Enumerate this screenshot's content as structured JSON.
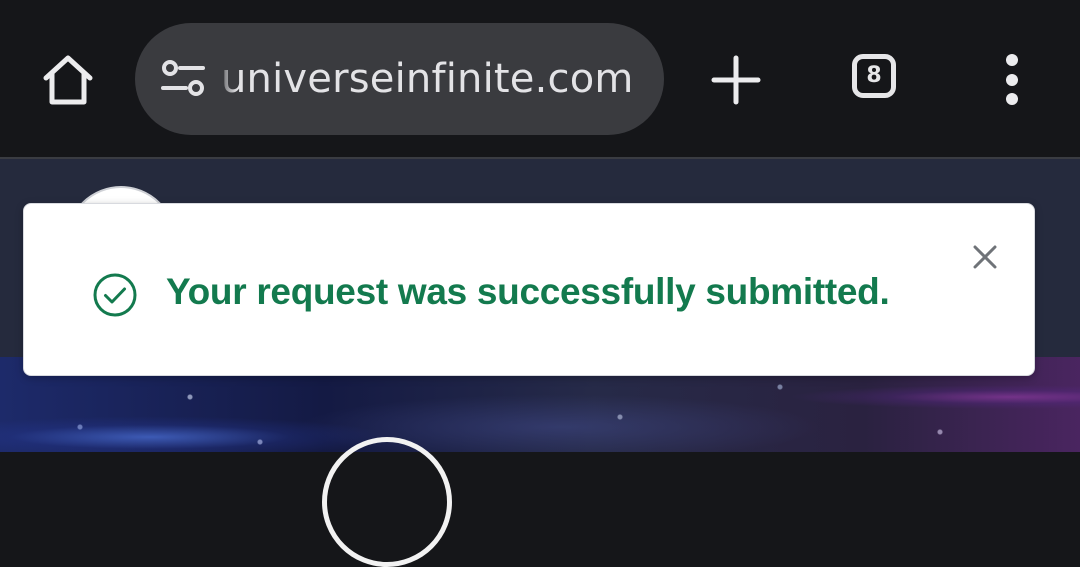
{
  "browser": {
    "url_text": "universeinfinite.com",
    "tab_count": "8",
    "icons": {
      "home": "home-icon",
      "site_settings": "tune-icon",
      "new_tab": "plus-icon",
      "tabs": "tab-switcher-icon",
      "menu": "more-vert-icon"
    }
  },
  "toast": {
    "message": "Your request was successfully submitted.",
    "status": "success",
    "icons": {
      "status": "check-circle-icon",
      "close": "close-icon"
    }
  },
  "colors": {
    "toolbar_bg": "#151619",
    "url_pill_bg": "#3a3b3f",
    "success_green": "#137a4e",
    "page_header_bg": "#252a3d"
  }
}
